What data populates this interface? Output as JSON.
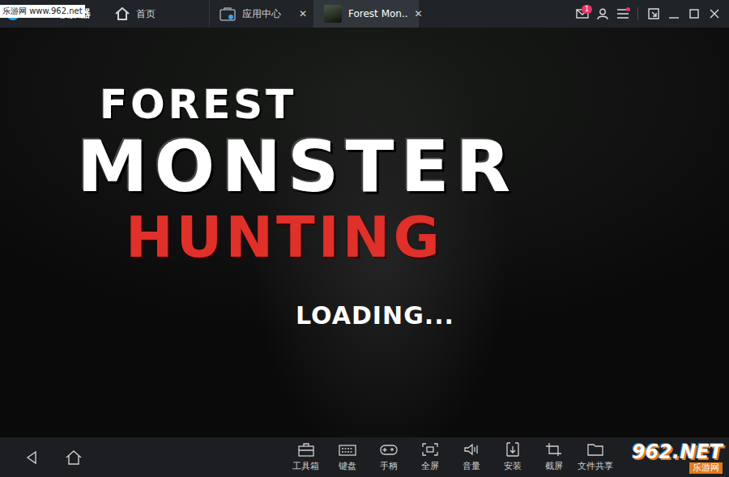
{
  "watermarks": {
    "top": "乐游网 www.962.net",
    "bottom_logo": "962.NET",
    "bottom_sub": "乐游网"
  },
  "app": {
    "name": "MuMu模拟器"
  },
  "tabs": [
    {
      "label": "首页",
      "selected": false,
      "closable": false,
      "close": ""
    },
    {
      "label": "应用中心",
      "selected": false,
      "closable": true,
      "close": "✕"
    },
    {
      "label": "Forest Mon..",
      "selected": true,
      "closable": true,
      "close": "✕"
    }
  ],
  "header": {
    "mail_badge": "1",
    "menu_notification": true
  },
  "game": {
    "title_top": "FOREST",
    "title_main": "MONSTER",
    "title_sub": "HUNTING",
    "status": "LOADING..."
  },
  "toolbar": [
    {
      "label": "工具箱"
    },
    {
      "label": "键盘"
    },
    {
      "label": "手柄"
    },
    {
      "label": "全屏"
    },
    {
      "label": "音量"
    },
    {
      "label": "安装"
    },
    {
      "label": "截屏"
    },
    {
      "label": "文件共享"
    }
  ]
}
